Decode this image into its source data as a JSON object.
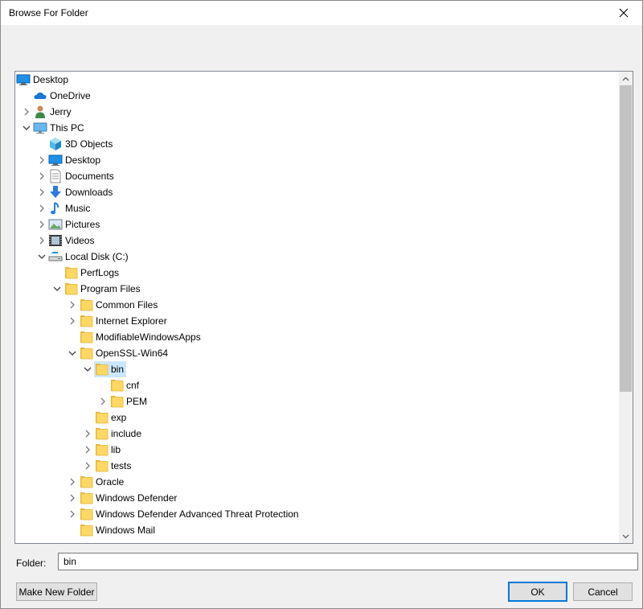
{
  "window": {
    "title": "Browse For Folder"
  },
  "tree": {
    "items": [
      {
        "label": "Desktop",
        "icon": "desktop-icon",
        "depth": 0,
        "expander": "none"
      },
      {
        "label": "OneDrive",
        "icon": "onedrive-cloud-icon",
        "depth": 1,
        "expander": "none"
      },
      {
        "label": "Jerry",
        "icon": "user-icon",
        "depth": 1,
        "expander": "collapsed"
      },
      {
        "label": "This PC",
        "icon": "computer-icon",
        "depth": 1,
        "expander": "expanded"
      },
      {
        "label": "3D Objects",
        "icon": "3d-objects-icon",
        "depth": 2,
        "expander": "none"
      },
      {
        "label": "Desktop",
        "icon": "desktop-icon",
        "depth": 2,
        "expander": "collapsed"
      },
      {
        "label": "Documents",
        "icon": "documents-icon",
        "depth": 2,
        "expander": "collapsed"
      },
      {
        "label": "Downloads",
        "icon": "download-arrow-icon",
        "depth": 2,
        "expander": "collapsed"
      },
      {
        "label": "Music",
        "icon": "music-note-icon",
        "depth": 2,
        "expander": "collapsed"
      },
      {
        "label": "Pictures",
        "icon": "pictures-icon",
        "depth": 2,
        "expander": "collapsed"
      },
      {
        "label": "Videos",
        "icon": "videos-icon",
        "depth": 2,
        "expander": "collapsed"
      },
      {
        "label": "Local Disk (C:)",
        "icon": "local-disk-icon",
        "depth": 2,
        "expander": "expanded"
      },
      {
        "label": "PerfLogs",
        "icon": "folder-icon",
        "depth": 3,
        "expander": "none"
      },
      {
        "label": "Program Files",
        "icon": "folder-icon",
        "depth": 3,
        "expander": "expanded"
      },
      {
        "label": "Common Files",
        "icon": "folder-icon",
        "depth": 4,
        "expander": "collapsed"
      },
      {
        "label": "Internet Explorer",
        "icon": "folder-icon",
        "depth": 4,
        "expander": "collapsed"
      },
      {
        "label": "ModifiableWindowsApps",
        "icon": "folder-icon",
        "depth": 4,
        "expander": "none"
      },
      {
        "label": "OpenSSL-Win64",
        "icon": "folder-icon",
        "depth": 4,
        "expander": "expanded"
      },
      {
        "label": "bin",
        "icon": "folder-icon",
        "depth": 5,
        "expander": "expanded",
        "selected": true
      },
      {
        "label": "cnf",
        "icon": "folder-icon",
        "depth": 6,
        "expander": "none"
      },
      {
        "label": "PEM",
        "icon": "folder-icon",
        "depth": 6,
        "expander": "collapsed"
      },
      {
        "label": "exp",
        "icon": "folder-icon",
        "depth": 5,
        "expander": "none"
      },
      {
        "label": "include",
        "icon": "folder-icon",
        "depth": 5,
        "expander": "collapsed"
      },
      {
        "label": "lib",
        "icon": "folder-icon",
        "depth": 5,
        "expander": "collapsed"
      },
      {
        "label": "tests",
        "icon": "folder-icon",
        "depth": 5,
        "expander": "collapsed"
      },
      {
        "label": "Oracle",
        "icon": "folder-icon",
        "depth": 4,
        "expander": "collapsed"
      },
      {
        "label": "Windows Defender",
        "icon": "folder-icon",
        "depth": 4,
        "expander": "collapsed"
      },
      {
        "label": "Windows Defender Advanced Threat Protection",
        "icon": "folder-icon",
        "depth": 4,
        "expander": "collapsed"
      },
      {
        "label": "Windows Mail",
        "icon": "folder-icon",
        "depth": 4,
        "expander": "none"
      }
    ]
  },
  "folder": {
    "label": "Folder:",
    "value": "bin"
  },
  "buttons": {
    "make_new_folder": "Make New Folder",
    "ok": "OK",
    "cancel": "Cancel"
  },
  "colors": {
    "selection": "#cce8ff",
    "folder": "#ffd863",
    "accent": "#0078d7"
  }
}
